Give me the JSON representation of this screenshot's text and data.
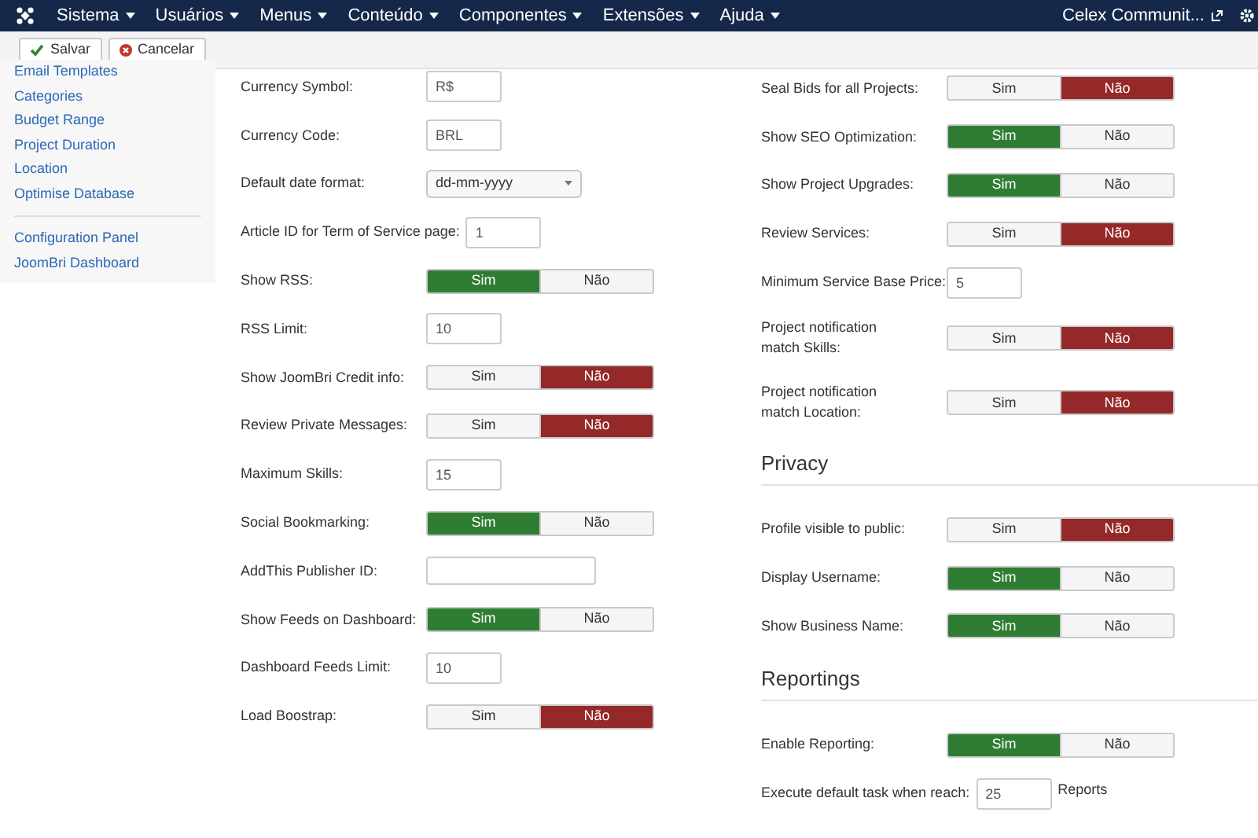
{
  "navbar": {
    "menus": [
      {
        "label": "Sistema"
      },
      {
        "label": "Usuários"
      },
      {
        "label": "Menus"
      },
      {
        "label": "Conteúdo"
      },
      {
        "label": "Componentes"
      },
      {
        "label": "Extensões"
      },
      {
        "label": "Ajuda"
      }
    ],
    "site_link": "Celex Communit..."
  },
  "toolbar": {
    "buttons": [
      {
        "kind": "save",
        "label": "Salvar"
      },
      {
        "kind": "cancel",
        "label": "Cancelar"
      }
    ]
  },
  "sidebar": {
    "groups": [
      [
        "Email Templates",
        "Categories",
        "Budget Range",
        "Project Duration",
        "Location",
        "Optimise Database"
      ],
      [
        "Configuration Panel",
        "JoomBri Dashboard"
      ]
    ]
  },
  "left_fields": [
    {
      "kind": "text",
      "label": "Currency Symbol:",
      "value": "R$"
    },
    {
      "kind": "text",
      "label": "Currency Code:",
      "value": "BRL"
    },
    {
      "kind": "select",
      "label": "Default date format:",
      "value": "dd-mm-yyyy"
    },
    {
      "kind": "text",
      "label": "Article ID for Term of Service page:",
      "value": "1"
    },
    {
      "kind": "toggle",
      "label": "Show RSS:",
      "options": [
        {
          "label": "Sim",
          "selected": true
        },
        {
          "label": "Não",
          "selected": false
        }
      ]
    },
    {
      "kind": "text",
      "label": "RSS Limit:",
      "value": "10"
    },
    {
      "kind": "toggle",
      "label": "Show JoomBri Credit info:",
      "options": [
        {
          "label": "Sim",
          "selected": false
        },
        {
          "label": "Não",
          "selected": true
        }
      ]
    },
    {
      "kind": "toggle",
      "label": "Review Private Messages:",
      "options": [
        {
          "label": "Sim",
          "selected": false
        },
        {
          "label": "Não",
          "selected": true
        }
      ]
    },
    {
      "kind": "text",
      "label": "Maximum Skills:",
      "value": "15"
    },
    {
      "kind": "toggle",
      "label": "Social Bookmarking:",
      "options": [
        {
          "label": "Sim",
          "selected": true
        },
        {
          "label": "Não",
          "selected": false
        }
      ]
    },
    {
      "kind": "wide_text",
      "label": "AddThis Publisher ID:"
    },
    {
      "kind": "toggle",
      "label": "Show Feeds on Dashboard:",
      "options": [
        {
          "label": "Sim",
          "selected": true
        },
        {
          "label": "Não",
          "selected": false
        }
      ]
    },
    {
      "kind": "text",
      "label": "Dashboard Feeds Limit:",
      "value": "10"
    },
    {
      "kind": "toggle",
      "label": "Load Boostrap:",
      "options": [
        {
          "label": "Sim",
          "selected": false
        },
        {
          "label": "Não",
          "selected": true
        }
      ]
    }
  ],
  "right_sections": [
    {
      "fields": [
        {
          "kind": "toggle",
          "label": "Seal Bids for all Projects:",
          "options": [
            {
              "label": "Sim",
              "selected": false
            },
            {
              "label": "Não",
              "selected": true
            }
          ]
        },
        {
          "kind": "toggle",
          "label": "Show SEO Optimization:",
          "options": [
            {
              "label": "Sim",
              "selected": true
            },
            {
              "label": "Não",
              "selected": false
            }
          ]
        },
        {
          "kind": "toggle",
          "label": "Show Project Upgrades:",
          "options": [
            {
              "label": "Sim",
              "selected": true
            },
            {
              "label": "Não",
              "selected": false
            }
          ]
        },
        {
          "kind": "toggle",
          "label": "Review Services:",
          "options": [
            {
              "label": "Sim",
              "selected": false
            },
            {
              "label": "Não",
              "selected": true
            }
          ]
        },
        {
          "kind": "text",
          "label": "Minimum Service Base Price:",
          "value": "5"
        },
        {
          "kind": "toggle",
          "label": "Project notification match Skills:",
          "options": [
            {
              "label": "Sim",
              "selected": false
            },
            {
              "label": "Não",
              "selected": true
            }
          ]
        },
        {
          "kind": "toggle",
          "label": "Project notification match Location:",
          "options": [
            {
              "label": "Sim",
              "selected": false
            },
            {
              "label": "Não",
              "selected": true
            }
          ]
        }
      ]
    },
    {
      "heading": "Privacy",
      "fields": [
        {
          "kind": "toggle",
          "label": "Profile visible to public:",
          "options": [
            {
              "label": "Sim",
              "selected": false
            },
            {
              "label": "Não",
              "selected": true
            }
          ]
        },
        {
          "kind": "toggle",
          "label": "Display Username:",
          "options": [
            {
              "label": "Sim",
              "selected": true
            },
            {
              "label": "Não",
              "selected": false
            }
          ]
        },
        {
          "kind": "toggle",
          "label": "Show Business Name:",
          "options": [
            {
              "label": "Sim",
              "selected": true
            },
            {
              "label": "Não",
              "selected": false
            }
          ]
        }
      ]
    },
    {
      "heading": "Reportings",
      "fields": [
        {
          "kind": "toggle",
          "label": "Enable Reporting:",
          "options": [
            {
              "label": "Sim",
              "selected": true
            },
            {
              "label": "Não",
              "selected": false
            }
          ]
        },
        {
          "kind": "text",
          "label": "Execute default task when reach:",
          "value": "25",
          "suffix": "Reports"
        }
      ]
    }
  ]
}
